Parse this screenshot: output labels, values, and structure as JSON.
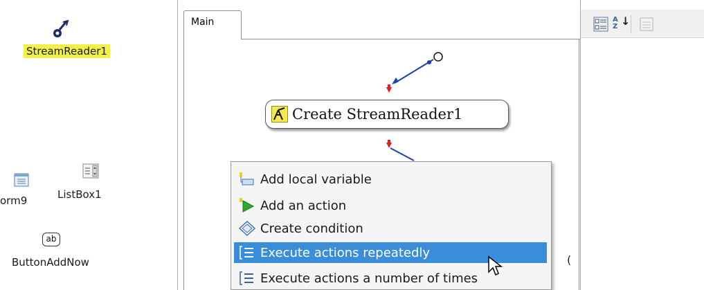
{
  "tray": {
    "components": [
      {
        "name": "stream-reader",
        "label": "StreamReader1",
        "icon": "stream-reader-icon"
      },
      {
        "name": "form",
        "label": "orm9",
        "icon": "form-icon"
      },
      {
        "name": "listbox",
        "label": "ListBox1",
        "icon": "listbox-icon"
      },
      {
        "name": "button",
        "label": "ButtonAddNow",
        "icon": "button-ab-icon"
      }
    ],
    "button_icon_text": "ab"
  },
  "designer": {
    "tab_label": "Main",
    "node_label": "Create StreamReader1",
    "stray_char": "("
  },
  "context_menu": {
    "items": [
      {
        "label": "Add local variable",
        "icon": "add-variable-icon",
        "selected": false
      },
      {
        "label": "Add an action",
        "icon": "add-action-icon",
        "selected": false
      },
      {
        "label": "Create condition",
        "icon": "condition-diamond-icon",
        "selected": false
      },
      {
        "label": "Execute actions repeatedly",
        "icon": "loop-icon",
        "selected": true
      },
      {
        "label": "Execute actions a number of times",
        "icon": "loop-count-icon",
        "selected": false
      }
    ]
  },
  "properties": {
    "toolbar": [
      "categorized-icon",
      "alphabetical-sort-icon",
      "property-pages-icon"
    ],
    "sort_icon_text": "AZ"
  },
  "colors": {
    "selection": "#3a8ed9",
    "highlight": "#f3f04a",
    "connector": "#1f3fb0",
    "arrow": "#e02020"
  }
}
